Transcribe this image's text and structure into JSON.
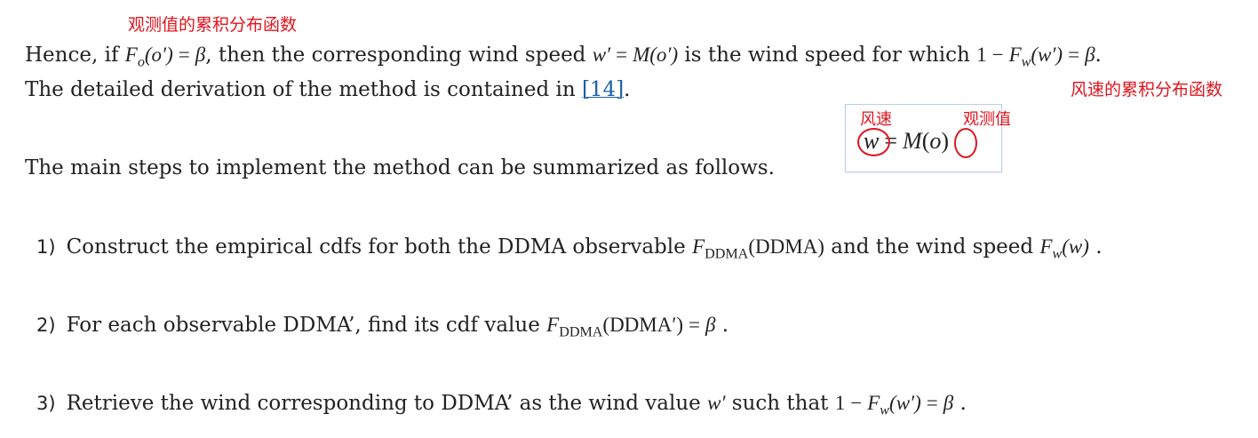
{
  "annotations": {
    "observed_cdf": "观测值的累积分布函数",
    "wind_cdf": "风速的累积分布函数",
    "wind_speed": "风速",
    "observed_value": "观测值"
  },
  "paragraph1": {
    "t1": "Hence, if ",
    "t2": ", then the corresponding wind speed ",
    "t3": " is the wind speed for which ",
    "t4": "The detailed derivation of the method is contained in ",
    "ref": "[14]",
    "t5": "."
  },
  "paragraph2": {
    "text": "The main steps to implement the method can be summarized as follows."
  },
  "steps": [
    {
      "num": "1)",
      "t1": "Construct the empirical cdfs for both the DDMA observable ",
      "t2": " and the wind speed ",
      "t3": " ."
    },
    {
      "num": "2)",
      "t1": "For each observable DDMA’, find its cdf value ",
      "t2": " ."
    },
    {
      "num": "3)",
      "t1": "Retrieve the wind corresponding to DDMA’ as the wind value ",
      "t2": " such that ",
      "t3": " ."
    }
  ],
  "math": {
    "F": "F",
    "o_sub": "o",
    "w_sub": "w",
    "ddma_sub": "DDMA",
    "o_prime_arg": "(o′)",
    "w_prime_arg": "(w′)",
    "w_arg": "(w)",
    "ddma_arg": "(DDMA)",
    "ddma_prime_arg": "(DDMA′)",
    "eq": "=",
    "minus": "−",
    "one": "1",
    "beta": "β",
    "w_prime": "w′",
    "M": "M",
    "box_w": "w",
    "box_eq": "=",
    "box_M": "M",
    "box_lp": "(",
    "box_o": "o",
    "box_rp": ")"
  },
  "colors": {
    "annotation": "#e0141e",
    "link": "#1a5fa8",
    "box_border": "#b8cfea"
  }
}
